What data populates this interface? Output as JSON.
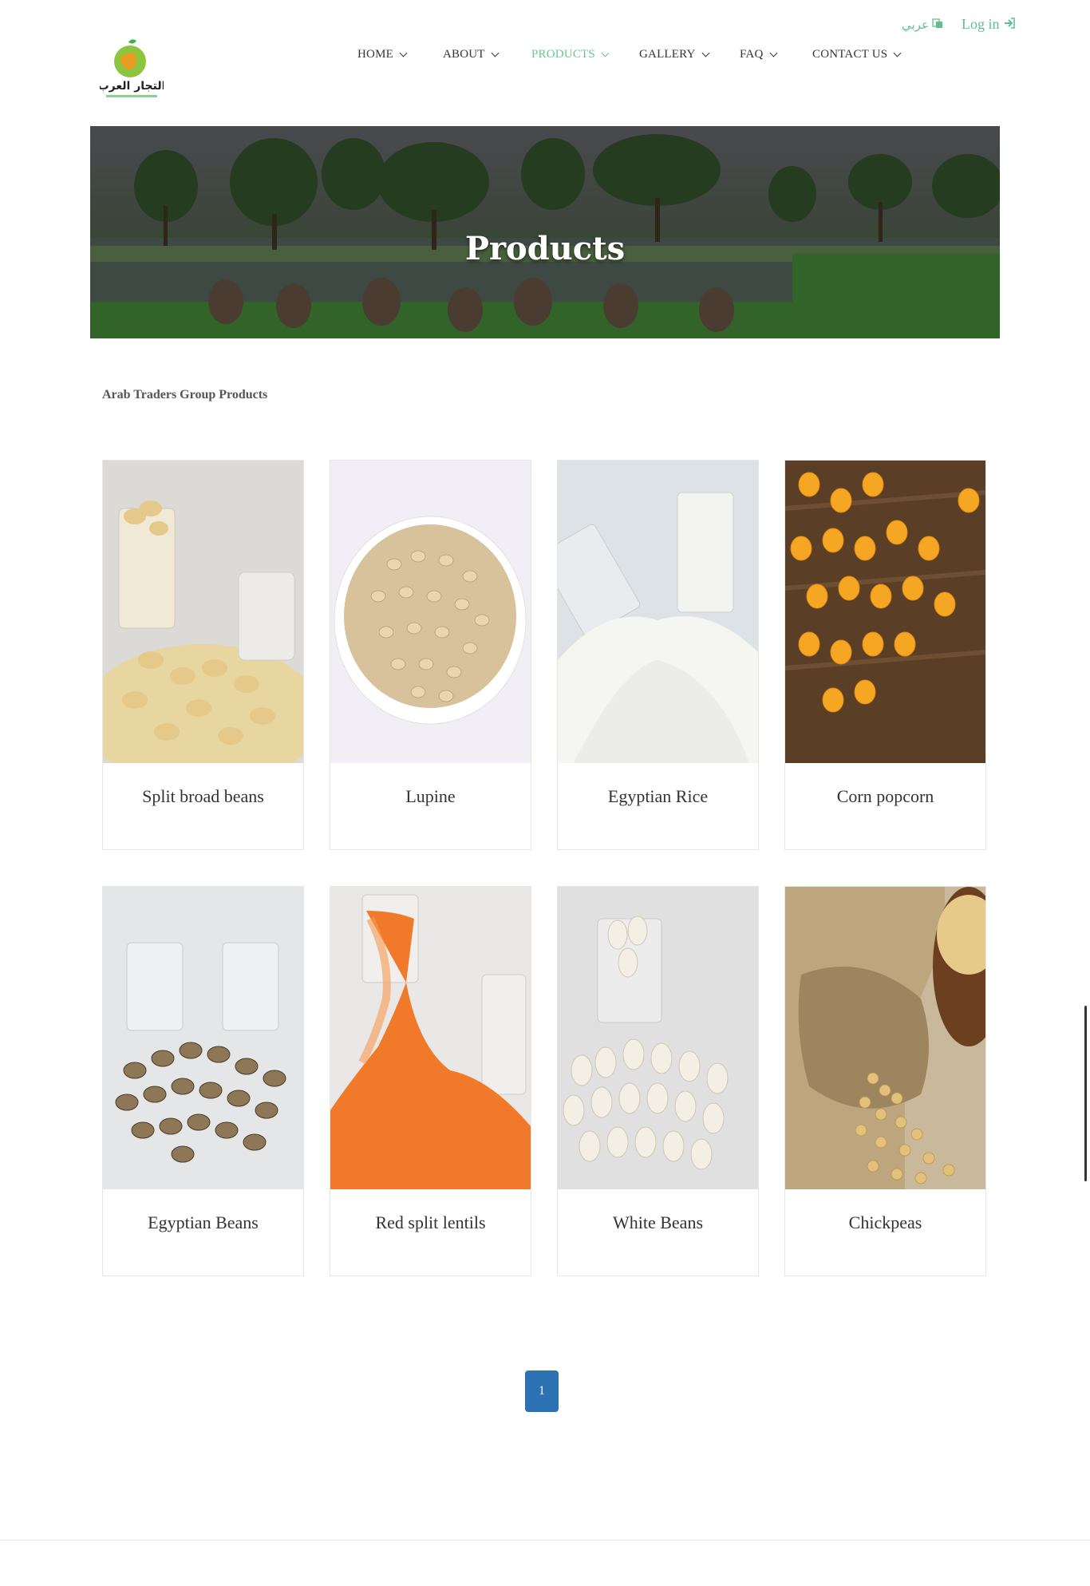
{
  "header": {
    "logo_text": "التجار العرب",
    "lang_label": "عربي",
    "login_label": "Log in",
    "nav": [
      {
        "label": "HOME"
      },
      {
        "label": "ABOUT"
      },
      {
        "label": "PRODUCTS"
      },
      {
        "label": "GALLERY"
      },
      {
        "label": "FAQ"
      },
      {
        "label": "CONTACT US"
      }
    ],
    "active_nav": "PRODUCTS"
  },
  "hero": {
    "title": "Products"
  },
  "section": {
    "heading": "Arab Traders Group Products"
  },
  "products": [
    {
      "name": "Split broad beans"
    },
    {
      "name": "Lupine"
    },
    {
      "name": "Egyptian Rice"
    },
    {
      "name": "Corn popcorn"
    },
    {
      "name": "Egyptian Beans"
    },
    {
      "name": "Red split lentils"
    },
    {
      "name": "White Beans"
    },
    {
      "name": "Chickpeas"
    }
  ],
  "pagination": {
    "current": "1"
  },
  "colors": {
    "accent_green": "#6cc38f",
    "pager_blue": "#2d73b4"
  }
}
